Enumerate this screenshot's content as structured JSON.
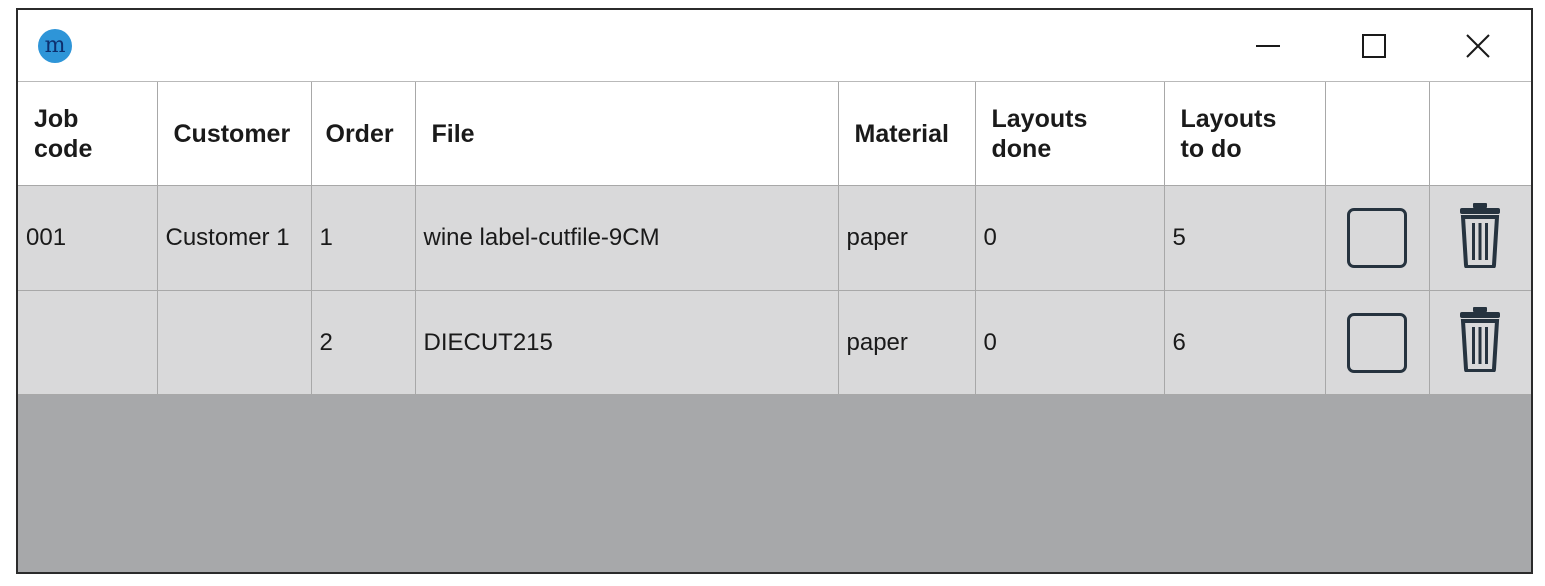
{
  "window": {
    "app_icon_glyph": "m",
    "controls": {
      "minimize": "minimize-icon",
      "maximize": "maximize-icon",
      "close": "close-icon"
    }
  },
  "table": {
    "headers": {
      "job_code": "Job code",
      "customer": "Customer",
      "order": "Order",
      "file": "File",
      "material": "Material",
      "layouts_done": "Layouts done",
      "layouts_to_do": "Layouts to do"
    },
    "rows": [
      {
        "job_code": "001",
        "customer": "Customer 1",
        "order": "1",
        "file": "wine label-cutfile-9CM",
        "material": "paper",
        "layouts_done": "0",
        "layouts_to_do": "5",
        "checked": false
      },
      {
        "job_code": "",
        "customer": "",
        "order": "2",
        "file": "DIECUT215",
        "material": "paper",
        "layouts_done": "0",
        "layouts_to_do": "6",
        "checked": false
      }
    ]
  },
  "colors": {
    "header_bg": "#ffffff",
    "row_bg": "#d9d9da",
    "empty_area_bg": "#a7a8aa",
    "grid_line": "#a8a8a8",
    "icon_dark": "#26333f",
    "app_icon_bg": "#2e95d8"
  }
}
